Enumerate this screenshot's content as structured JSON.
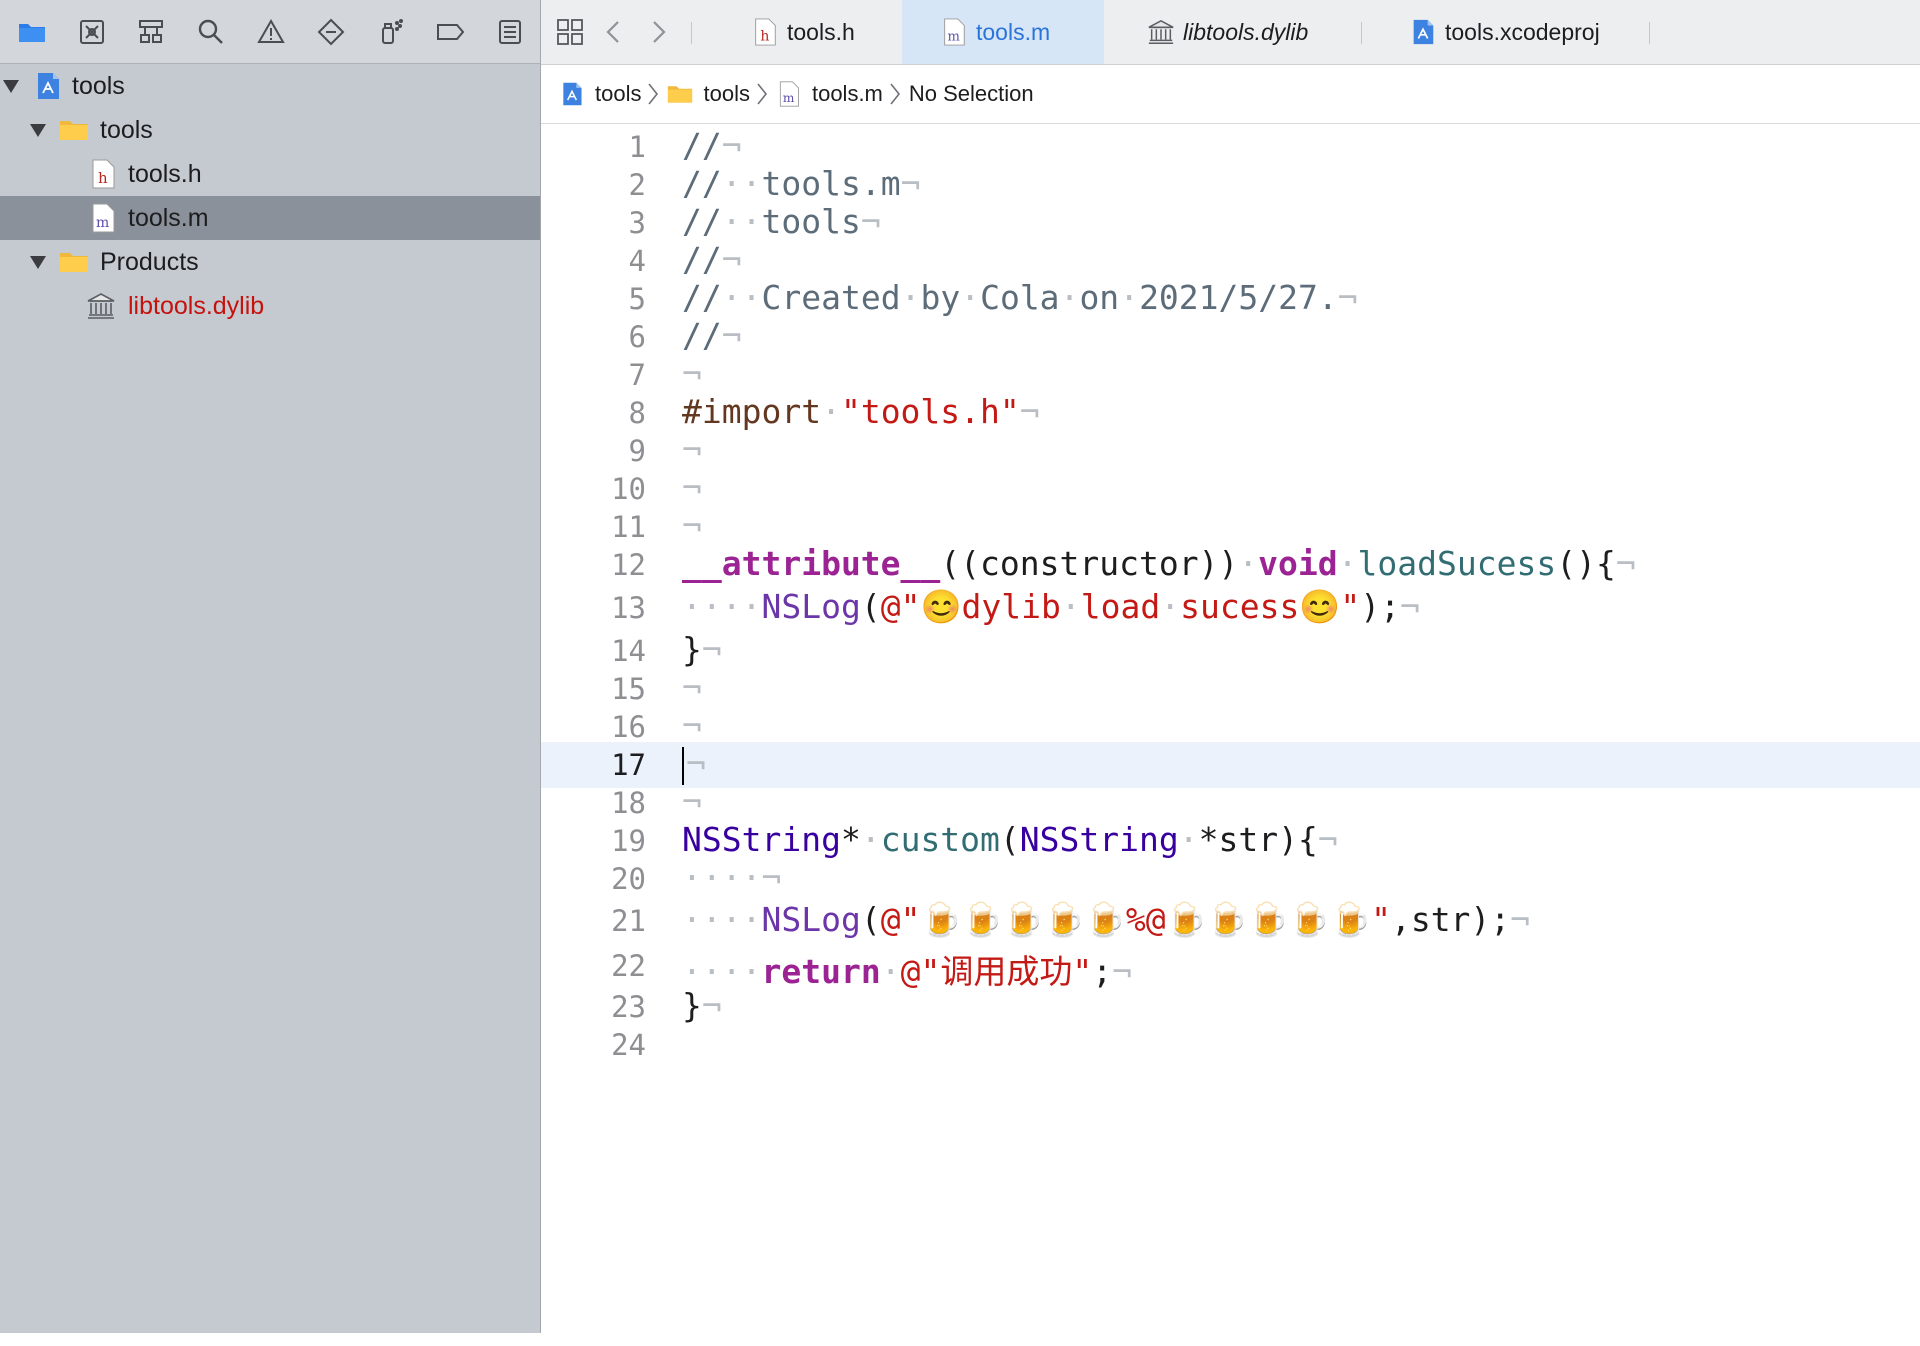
{
  "navigator": {
    "toolbar_icons": [
      "folder-icon",
      "source-control-icon",
      "hierarchy-icon",
      "search-icon",
      "warning-icon",
      "test-diamond-icon",
      "debug-spray-icon",
      "breakpoint-tag-icon",
      "report-list-icon"
    ],
    "tree": [
      {
        "label": "tools",
        "icon": "project-blueprint-icon",
        "expanded": true,
        "level": 0
      },
      {
        "label": "tools",
        "icon": "folder-icon",
        "expanded": true,
        "level": 1
      },
      {
        "label": "tools.h",
        "icon": "h-file-icon",
        "level": 2
      },
      {
        "label": "tools.m",
        "icon": "m-file-icon",
        "level": 2,
        "selected": true
      },
      {
        "label": "Products",
        "icon": "folder-icon",
        "expanded": true,
        "level": 1
      },
      {
        "label": "libtools.dylib",
        "icon": "library-icon",
        "level": 2,
        "missing": true
      }
    ]
  },
  "tabs": [
    {
      "label": "tools.h",
      "icon": "h-file-icon"
    },
    {
      "label": "tools.m",
      "icon": "m-file-icon",
      "active": true
    },
    {
      "label": "libtools.dylib",
      "icon": "library-icon",
      "italic": true
    },
    {
      "label": "tools.xcodeproj",
      "icon": "project-blueprint-icon"
    }
  ],
  "jumpbar": {
    "project": "tools",
    "group": "tools",
    "file": "tools.m",
    "symbol": "No Selection"
  },
  "editor": {
    "current_line": 17,
    "lines": [
      {
        "n": "1",
        "t": "//¬"
      },
      {
        "n": "2",
        "t": "//··tools.m¬"
      },
      {
        "n": "3",
        "t": "//··tools¬"
      },
      {
        "n": "4",
        "t": "//¬"
      },
      {
        "n": "5",
        "t": "//··Created·by·Cola·on·2021/5/27.¬"
      },
      {
        "n": "6",
        "t": "//¬"
      },
      {
        "n": "7",
        "t": "¬"
      },
      {
        "n": "8",
        "t": "#import·\"tools.h\"¬"
      },
      {
        "n": "9",
        "t": "¬"
      },
      {
        "n": "10",
        "t": "¬"
      },
      {
        "n": "11",
        "t": "¬"
      },
      {
        "n": "12",
        "t": "__attribute__((constructor))·void·loadSucess(){¬"
      },
      {
        "n": "13",
        "t": "····NSLog(@\"😊dylib·load·sucess😊\");¬"
      },
      {
        "n": "14",
        "t": "}¬"
      },
      {
        "n": "15",
        "t": "¬"
      },
      {
        "n": "16",
        "t": "¬"
      },
      {
        "n": "17",
        "t": "¬"
      },
      {
        "n": "18",
        "t": "¬"
      },
      {
        "n": "19",
        "t": "NSString*·custom(NSString·*str){¬"
      },
      {
        "n": "20",
        "t": "····¬"
      },
      {
        "n": "21",
        "t": "····NSLog(@\"🍺🍺🍺🍺🍺%@🍺🍺🍺🍺🍺\",str);¬"
      },
      {
        "n": "22",
        "t": "····return·@\"调用成功\";¬"
      },
      {
        "n": "23",
        "t": "}¬"
      },
      {
        "n": "24",
        "t": ""
      }
    ]
  },
  "colors": {
    "comment": "#5d6c79",
    "preprocessor": "#643820",
    "string": "#c41a16",
    "keyword": "#9b2393",
    "function": "#326d74",
    "type": "#3900a0",
    "call": "#6c36a9",
    "active_tab": "#2a74d8",
    "missing_file": "#c5120d"
  }
}
